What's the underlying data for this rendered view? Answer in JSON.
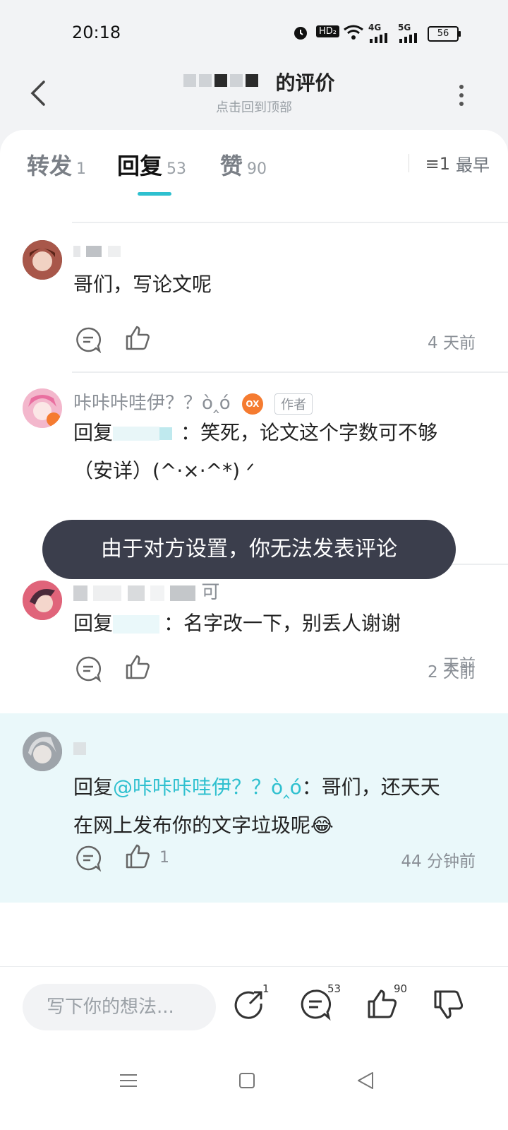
{
  "status": {
    "time": "20:18",
    "hd": "HD₂",
    "net1": "4G",
    "net2": "5G",
    "battery": "56"
  },
  "header": {
    "title": "的评价",
    "subtitle": "点击回到顶部"
  },
  "tabs": [
    {
      "label": "转发",
      "count": "1"
    },
    {
      "label": "回复",
      "count": "53"
    },
    {
      "label": "赞",
      "count": "90"
    }
  ],
  "sort_label": "最早",
  "comments": [
    {
      "text": "哥们，写论文呢",
      "time": "4 天前"
    },
    {
      "username": "咔咔咔哇伊？？ò‸ó",
      "badge": "作者",
      "vip": "OX",
      "reply_prefix": "回复",
      "text": "：笑死，论文这个字数可不够",
      "text2": "（安详）(^·×·^*) ᐟ",
      "time": "天前"
    },
    {
      "username_tail": "可",
      "reply_prefix": "回复",
      "text": "：名字改一下，别丢人谢谢",
      "time": "2 天前"
    },
    {
      "reply_prefix": "回复",
      "mention": "@咔咔咔哇伊？？ò‸ó",
      "text": "：哥们，还天天",
      "text2": "在网上发布你的文字垃圾呢😂",
      "likes": "1",
      "time": "44 分钟前"
    }
  ],
  "toast": "由于对方设置，你无法发表评论",
  "bottom_bar": {
    "placeholder": "写下你的想法...",
    "repost_count": "1",
    "comment_count": "53",
    "like_count": "90"
  },
  "colors": {
    "accent": "#2ec0cf",
    "toast_bg": "#3b3e4c",
    "highlight": "#eaf8fa"
  }
}
